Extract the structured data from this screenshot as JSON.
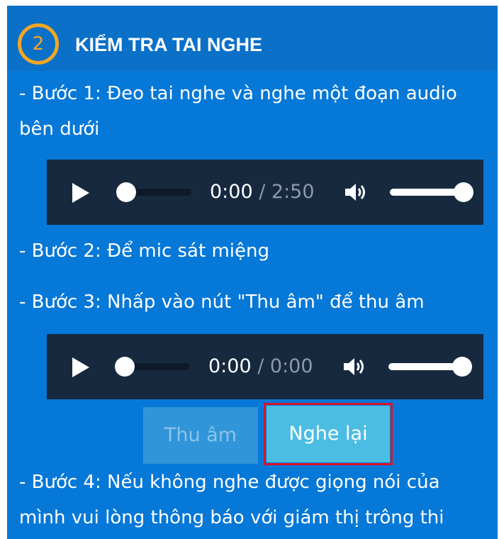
{
  "section": {
    "step_number": "2",
    "title": "KIỂM TRA TAI NGHE"
  },
  "steps": {
    "step1_line1": "- Bước 1: Đeo tai nghe và nghe một đoạn audio",
    "step1_line2": "bên dưới",
    "step2": "- Bước 2: Để mic sát miệng",
    "step3": "- Bước 3: Nhấp vào nút \"Thu âm\" để thu âm",
    "step4_line1": "- Bước 4: Nếu không nghe được giọng nói của",
    "step4_line2": "mình vui lòng thông báo với giám thị trông thi"
  },
  "audio_player_1": {
    "current_time": "0:00",
    "separator": " / ",
    "duration": "2:50",
    "progress": 0,
    "volume": 1.0,
    "icons": [
      "play-icon",
      "volume-icon"
    ]
  },
  "audio_player_2": {
    "current_time": "0:00",
    "separator": " / ",
    "duration": "0:00",
    "progress": 0,
    "volume": 1.0,
    "icons": [
      "play-icon",
      "volume-icon"
    ]
  },
  "buttons": {
    "record_label": "Thu âm",
    "record_enabled": false,
    "replay_label": "Nghe lại",
    "replay_highlighted": true
  },
  "colors": {
    "panel_bg": "#0678d7",
    "header_bg": "#0a70c8",
    "accent_orange": "#f5a623",
    "player_bg": "#16293f",
    "highlight_red": "#d9142a"
  }
}
